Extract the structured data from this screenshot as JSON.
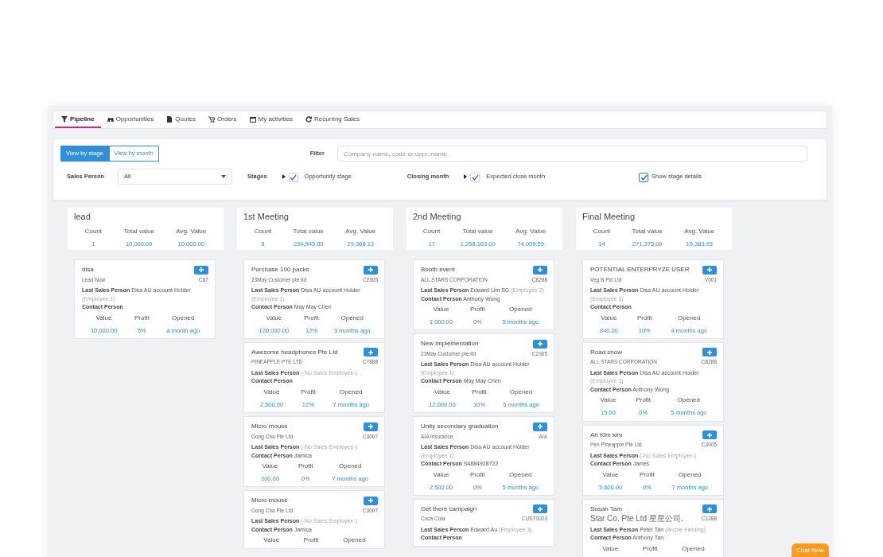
{
  "tabs": [
    {
      "label": "Pipeline",
      "selected": true
    },
    {
      "label": "Opportunities",
      "selected": false
    },
    {
      "label": "Quotes",
      "selected": false
    },
    {
      "label": "Orders",
      "selected": false
    },
    {
      "label": "My activities",
      "selected": false
    },
    {
      "label": "Recurring Sales",
      "selected": false
    }
  ],
  "view_toggle": [
    {
      "label": "View by stage",
      "selected": true
    },
    {
      "label": "View by month",
      "selected": false
    }
  ],
  "filter": {
    "label": "Filter",
    "placeholder": "Company name, code or oppr. name"
  },
  "sales_person": {
    "label": "Sales Person",
    "value": "All"
  },
  "stages": {
    "label": "Stages",
    "option": "Opportunity stage",
    "checked": true
  },
  "closing_month": {
    "label": "Closing month",
    "option": "Expected close month",
    "checked": true
  },
  "show_stage_details": {
    "label": "Show stage details",
    "checked": true
  },
  "columns": [
    {
      "title": "lead",
      "stats": [
        {
          "label": "Count",
          "value": "1"
        },
        {
          "label": "Total value",
          "value": "10,000.00"
        },
        {
          "label": "Avg. Value",
          "value": "10,000.00"
        }
      ],
      "cards": [
        {
          "title": "disa",
          "company": "Lead Now",
          "code": "C67",
          "last_sales": {
            "label": "Last Sales Person",
            "person": "Disa AU account Holder",
            "note": "(Employee 1)"
          },
          "contact": {
            "label": "Contact Person"
          },
          "metrics": [
            {
              "label": "Value",
              "value": "10,000.00"
            },
            {
              "label": "Profit",
              "value": "5%"
            },
            {
              "label": "Opened",
              "value": "a month ago"
            }
          ]
        }
      ]
    },
    {
      "title": "1st Meeting",
      "stats": [
        {
          "label": "Count",
          "value": "8"
        },
        {
          "label": "Total value",
          "value": "234,945.00"
        },
        {
          "label": "Avg. Value",
          "value": "29,368.13"
        }
      ],
      "cards": [
        {
          "title": "Purchase 100 packs",
          "company": "23May Customer pte ltd",
          "code": "C2305",
          "last_sales": {
            "label": "Last Sales Person",
            "person": "Disa AU account Holder",
            "note": "(Employee 1)"
          },
          "contact": {
            "label": "Contact Person",
            "person": "May May Chen"
          },
          "metrics": [
            {
              "label": "Value",
              "value": "120,000.00"
            },
            {
              "label": "Profit",
              "value": "12%"
            },
            {
              "label": "Opened",
              "value": "3 months ago"
            }
          ]
        },
        {
          "title": "Awesome headphones Pte Ltd",
          "company": "PINEAPPLE PTE LTD",
          "code": "C7888",
          "last_sales": {
            "label": "Last Sales Person",
            "note": "(-No Sales Employee-)"
          },
          "contact": {
            "label": "Contact Person"
          },
          "metrics": [
            {
              "label": "Value",
              "value": "2,500.00"
            },
            {
              "label": "Profit",
              "value": "12%"
            },
            {
              "label": "Opened",
              "value": "7 months ago"
            }
          ]
        },
        {
          "title": "Micro mouse",
          "company": "Gong Cha Pte Ltd",
          "code": "C3007",
          "last_sales": {
            "label": "Last Sales Person",
            "note": "(-No Sales Employee-)"
          },
          "contact": {
            "label": "Contact Person",
            "person": "Jamica"
          },
          "metrics": [
            {
              "label": "Value",
              "value": "200.00"
            },
            {
              "label": "Profit",
              "value": "0%"
            },
            {
              "label": "Opened",
              "value": "7 months ago"
            }
          ]
        },
        {
          "title": "Micro mouse",
          "company": "Gong Cha Pte Ltd",
          "code": "C3007",
          "last_sales": {
            "label": "Last Sales Person",
            "note": "(-No Sales Employee-)"
          },
          "contact": {
            "label": "Contact Person",
            "person": "Jamica"
          },
          "metrics": [
            {
              "label": "Value"
            },
            {
              "label": "Profit"
            },
            {
              "label": "Opened"
            }
          ]
        }
      ]
    },
    {
      "title": "2nd Meeting",
      "stats": [
        {
          "label": "Count",
          "value": "17"
        },
        {
          "label": "Total value",
          "value": "1,258,163.00"
        },
        {
          "label": "Avg. Value",
          "value": "74,009.59"
        }
      ],
      "cards": [
        {
          "title": "Booth event",
          "company": "ALL STARS CORPORATION",
          "code": "C8288",
          "last_sales": {
            "label": "Last Sales Person",
            "person": "Edward Lim SG",
            "note": "(Employee 2)"
          },
          "contact": {
            "label": "Contact Person",
            "person": "Anthony Wong"
          },
          "metrics": [
            {
              "label": "Value",
              "value": "1,000.00"
            },
            {
              "label": "Profit",
              "value": "0%"
            },
            {
              "label": "Opened",
              "value": "5 months ago"
            }
          ]
        },
        {
          "title": "New implementation",
          "company": "23May Customer pte ltd",
          "code": "C2305",
          "last_sales": {
            "label": "Last Sales Person",
            "person": "Disa AU account Holder",
            "note": "(Employee 1)"
          },
          "contact": {
            "label": "Contact Person",
            "person": "May May Chen"
          },
          "metrics": [
            {
              "label": "Value",
              "value": "12,000.00"
            },
            {
              "label": "Profit",
              "value": "10%"
            },
            {
              "label": "Opened",
              "value": "5 months ago"
            }
          ]
        },
        {
          "title": "Unity secondary graduation",
          "company": "AIA Insurance",
          "code": "AIA",
          "last_sales": {
            "label": "Last Sales Person",
            "person": "Disa AU account Holder",
            "note": "(Employee 1)"
          },
          "contact": {
            "label": "Contact Person",
            "person": "S4884928722"
          },
          "metrics": [
            {
              "label": "Value",
              "value": "2,500.00"
            },
            {
              "label": "Profit",
              "value": "0%"
            },
            {
              "label": "Opened",
              "value": "5 months ago"
            }
          ]
        },
        {
          "title": "Get there campaign",
          "company": "Coca Cola",
          "code": "CUST0023",
          "last_sales": {
            "label": "Last Sales Person",
            "person": "Edward Au",
            "note": "(Employee 3)"
          },
          "contact": {
            "label": "Contact Person"
          }
        }
      ]
    },
    {
      "title": "Final Meeting",
      "stats": [
        {
          "label": "Count",
          "value": "14"
        },
        {
          "label": "Total value",
          "value": "271,375.00"
        },
        {
          "label": "Avg. Value",
          "value": "19,383.93"
        }
      ],
      "cards": [
        {
          "title": "POTENTIAL ENTERPRYZE USER",
          "company": "Veg B Pld Ltd",
          "code": "V001",
          "last_sales": {
            "label": "Last Sales Person",
            "person": "Disa AU account Holder",
            "note": "(Employee 1)"
          },
          "contact": {
            "label": "Contact Person"
          },
          "metrics": [
            {
              "label": "Value",
              "value": "840.00"
            },
            {
              "label": "Profit",
              "value": "10%"
            },
            {
              "label": "Opened",
              "value": "4 months ago"
            }
          ]
        },
        {
          "title": "Road show",
          "company": "ALL STARS CORPORATION",
          "code": "C8288",
          "last_sales": {
            "label": "Last Sales Person",
            "person": "Disa AU account Holder",
            "note": "(Employee 1)"
          },
          "contact": {
            "label": "Contact Person",
            "person": "Anthony Wong"
          },
          "metrics": [
            {
              "label": "Value",
              "value": "15.00"
            },
            {
              "label": "Profit",
              "value": "0%"
            },
            {
              "label": "Opened",
              "value": "5 months ago"
            }
          ]
        },
        {
          "title": "Ah Kim kim",
          "company": "Pen Pineapple Pte Ltd",
          "code": "C3005",
          "last_sales": {
            "label": "Last Sales Person",
            "note": "(-No Sales Employee-)"
          },
          "contact": {
            "label": "Contact Person",
            "person": "James"
          },
          "metrics": [
            {
              "label": "Value",
              "value": "5,600.00"
            },
            {
              "label": "Profit",
              "value": "0%"
            },
            {
              "label": "Opened",
              "value": "7 months ago"
            }
          ]
        },
        {
          "title": "Susan Tam",
          "company": "Star Co. Pte Ltd 星星公司.",
          "code": "C1288",
          "last_sales": {
            "label": "Last Sales Person",
            "person": "Peter Tan",
            "note": "(Archie Fielding)"
          },
          "contact": {
            "label": "Contact Person",
            "person": "Anthony Tan"
          },
          "metrics": [
            {
              "label": "Value"
            },
            {
              "label": "Profit"
            },
            {
              "label": "Opened"
            }
          ]
        }
      ]
    }
  ],
  "chat_button": "Chat Now"
}
